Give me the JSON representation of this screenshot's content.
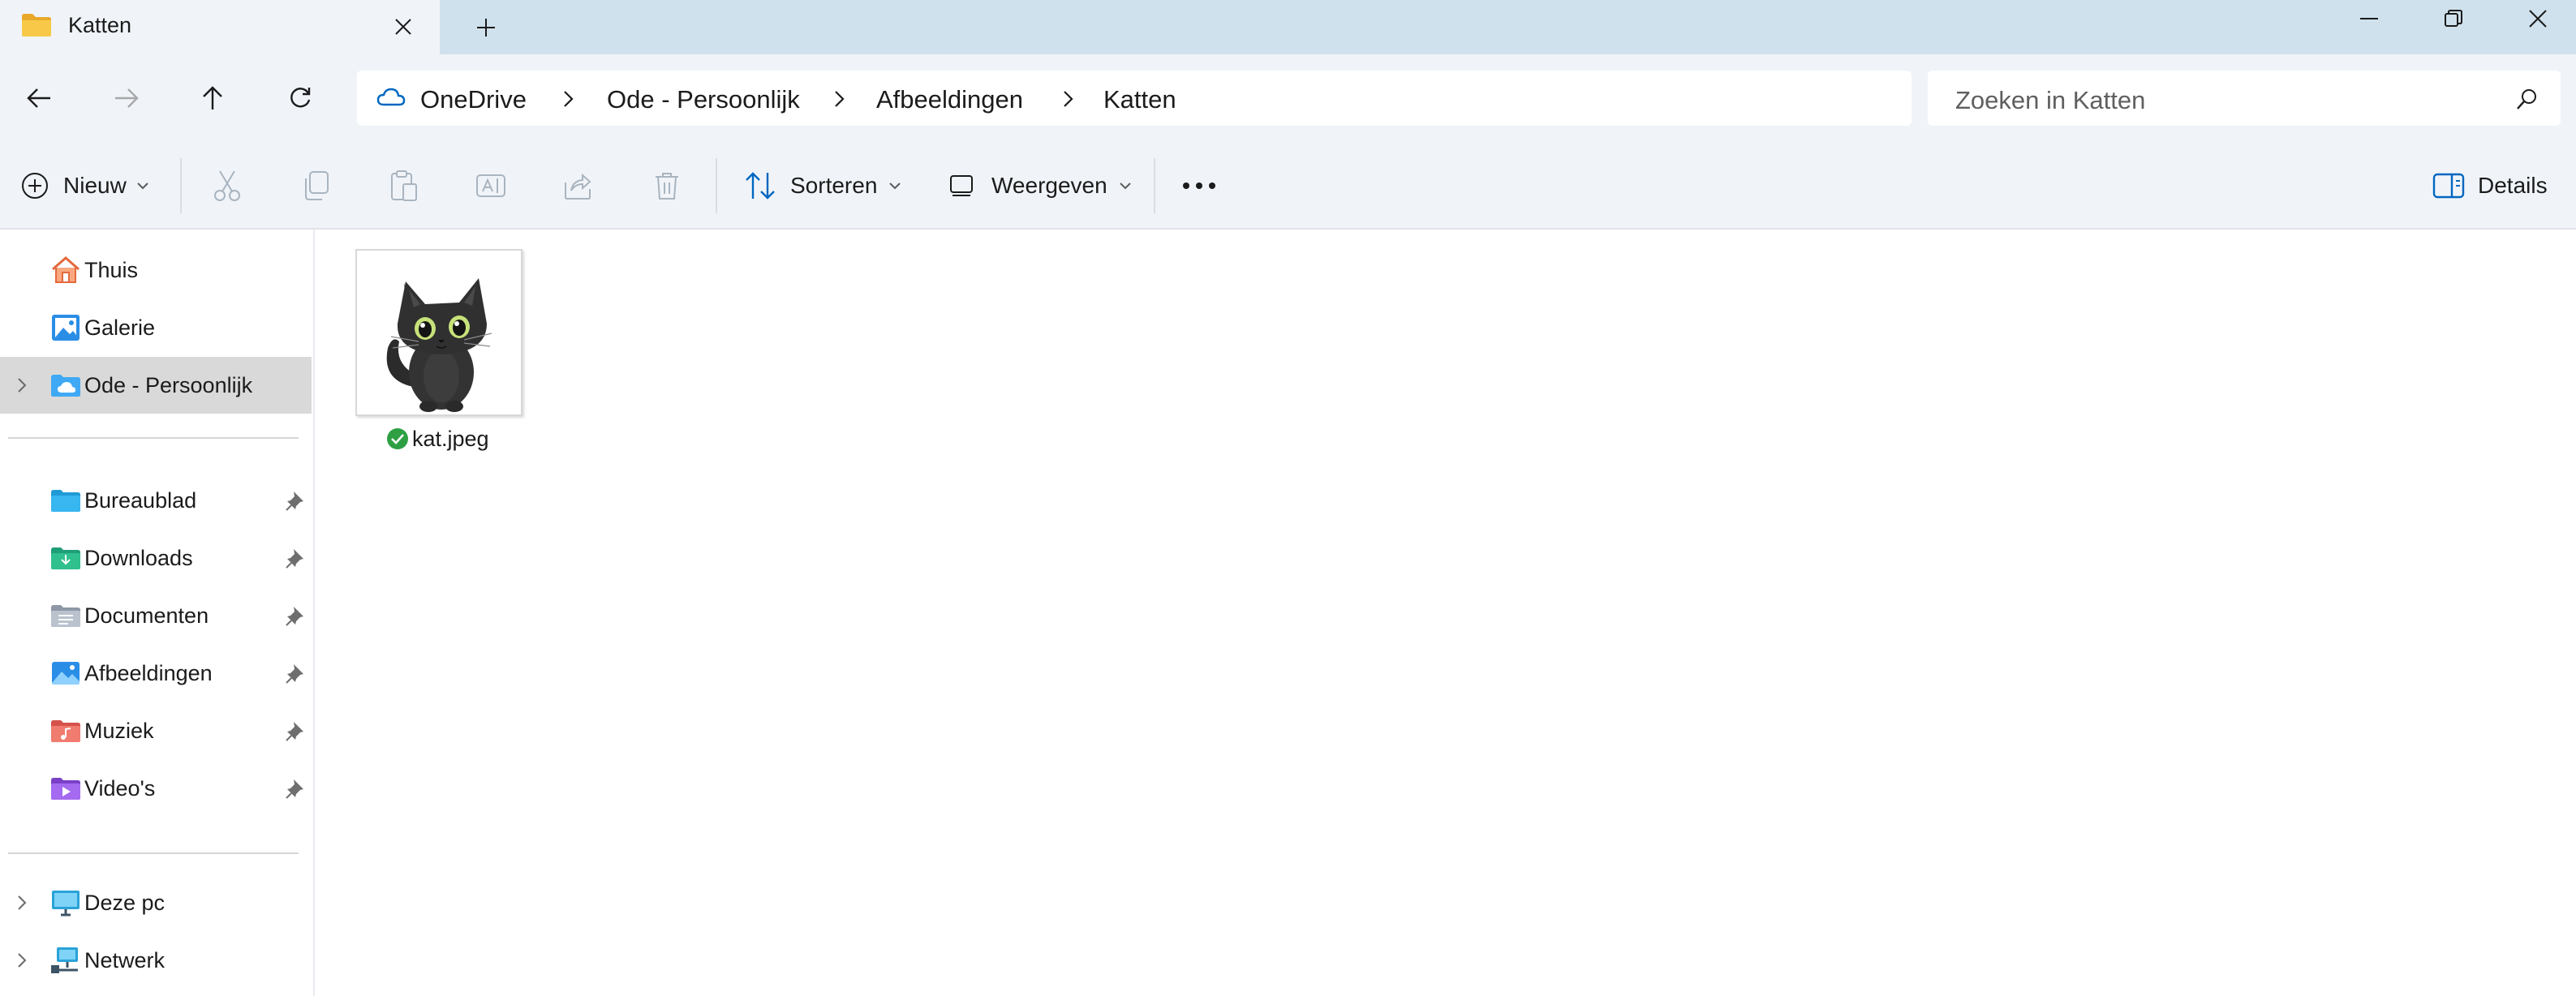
{
  "tab": {
    "title": "Katten"
  },
  "breadcrumb": [
    "OneDrive",
    "Ode - Persoonlijk",
    "Afbeeldingen",
    "Katten"
  ],
  "search": {
    "placeholder": "Zoeken in Katten"
  },
  "toolbar": {
    "new_label": "Nieuw",
    "sort_label": "Sorteren",
    "view_label": "Weergeven",
    "details_label": "Details"
  },
  "sidebar": {
    "top": [
      {
        "label": "Thuis",
        "icon": "home-icon"
      },
      {
        "label": "Galerie",
        "icon": "gallery-icon"
      },
      {
        "label": "Ode - Persoonlijk",
        "icon": "onedrive-folder-icon",
        "selected": true
      }
    ],
    "pinned": [
      {
        "label": "Bureaublad",
        "icon": "desktop-folder-icon"
      },
      {
        "label": "Downloads",
        "icon": "downloads-folder-icon"
      },
      {
        "label": "Documenten",
        "icon": "documents-folder-icon"
      },
      {
        "label": "Afbeeldingen",
        "icon": "pictures-folder-icon"
      },
      {
        "label": "Muziek",
        "icon": "music-folder-icon"
      },
      {
        "label": "Video's",
        "icon": "videos-folder-icon"
      }
    ],
    "bottom": [
      {
        "label": "Deze pc",
        "icon": "pc-icon"
      },
      {
        "label": "Netwerk",
        "icon": "network-icon"
      }
    ]
  },
  "files": [
    {
      "name": "kat.jpeg",
      "status": "synced"
    }
  ],
  "colors": {
    "titlebar": "#cfe1ec",
    "chrome": "#f0f4f9",
    "selected": "#d9d9d9",
    "accent": "#0067c0",
    "synced": "#2ea043"
  }
}
